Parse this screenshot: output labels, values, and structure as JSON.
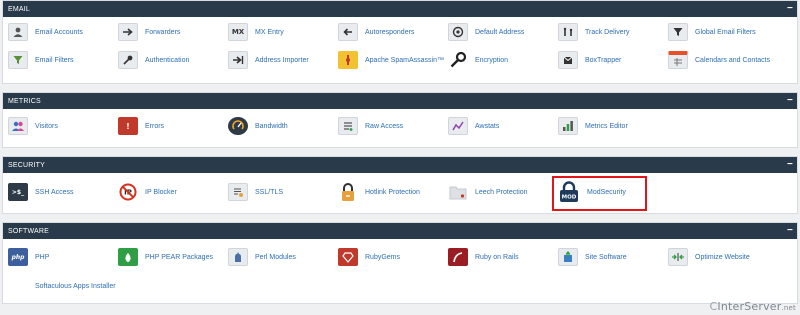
{
  "sections": {
    "email": {
      "title": "EMAIL",
      "collapse": "−",
      "items": [
        {
          "label": "Email Accounts",
          "icon": "person-icon"
        },
        {
          "label": "Forwarders",
          "icon": "forward-arrow-icon"
        },
        {
          "label": "MX Entry",
          "icon": "mx-icon"
        },
        {
          "label": "Autoresponders",
          "icon": "autoresponder-icon"
        },
        {
          "label": "Default Address",
          "icon": "at-sign-icon"
        },
        {
          "label": "Track Delivery",
          "icon": "track-icon"
        },
        {
          "label": "Global Email Filters",
          "icon": "filter-icon"
        },
        {
          "label": "Email Filters",
          "icon": "email-filter-icon"
        },
        {
          "label": "Authentication",
          "icon": "key-icon"
        },
        {
          "label": "Address Importer",
          "icon": "import-icon"
        },
        {
          "label": "Apache SpamAssassin™",
          "icon": "spam-icon"
        },
        {
          "label": "Encryption",
          "icon": "encryption-key-icon"
        },
        {
          "label": "BoxTrapper",
          "icon": "boxtrapper-icon"
        },
        {
          "label": "Calendars and Contacts",
          "icon": "calendar-icon"
        }
      ]
    },
    "metrics": {
      "title": "METRICS",
      "collapse": "−",
      "items": [
        {
          "label": "Visitors",
          "icon": "visitors-icon"
        },
        {
          "label": "Errors",
          "icon": "error-icon"
        },
        {
          "label": "Bandwidth",
          "icon": "gauge-icon"
        },
        {
          "label": "Raw Access",
          "icon": "raw-access-icon"
        },
        {
          "label": "Awstats",
          "icon": "chart-icon"
        },
        {
          "label": "Metrics Editor",
          "icon": "bars-icon"
        }
      ]
    },
    "security": {
      "title": "SECURITY",
      "collapse": "−",
      "items": [
        {
          "label": "SSH Access",
          "icon": "terminal-icon"
        },
        {
          "label": "IP Blocker",
          "icon": "ip-block-icon"
        },
        {
          "label": "SSL/TLS",
          "icon": "certificate-icon"
        },
        {
          "label": "Hotlink Protection",
          "icon": "padlock-icon"
        },
        {
          "label": "Leech Protection",
          "icon": "folder-icon"
        },
        {
          "label": "ModSecurity",
          "icon": "modsecurity-icon"
        }
      ]
    },
    "software": {
      "title": "SOFTWARE",
      "collapse": "−",
      "items": [
        {
          "label": "PHP",
          "icon": "php-icon"
        },
        {
          "label": "PHP PEAR Packages",
          "icon": "pear-icon"
        },
        {
          "label": "Perl Modules",
          "icon": "perl-icon"
        },
        {
          "label": "RubyGems",
          "icon": "ruby-icon"
        },
        {
          "label": "Ruby on Rails",
          "icon": "rails-icon"
        },
        {
          "label": "Site Software",
          "icon": "site-software-icon"
        },
        {
          "label": "Optimize Website",
          "icon": "optimize-icon"
        },
        {
          "label": "Softaculous Apps Installer",
          "icon": ""
        }
      ]
    }
  },
  "icon_glyphs": {
    "mx": "MX",
    "ssh": ">$_",
    "php": "php",
    "mod": "MOD"
  },
  "watermark": {
    "prefix": "C",
    "text": "InterServer",
    "suffix": ".net"
  },
  "colors": {
    "header_bg": "#293a4a",
    "link": "#2f6fb3",
    "highlight": "#e0161b"
  }
}
